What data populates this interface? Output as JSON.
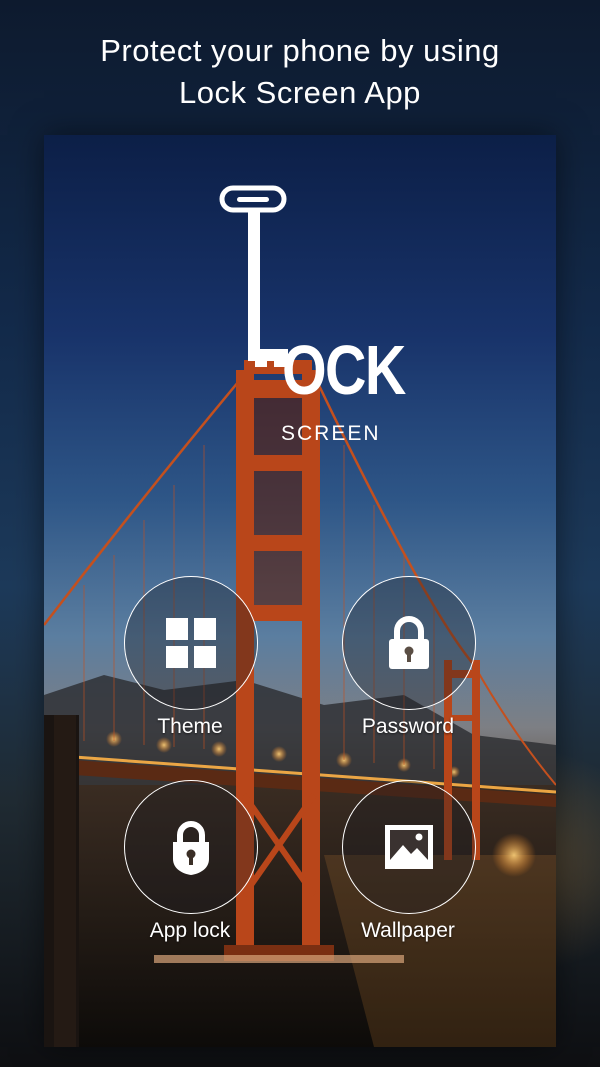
{
  "headline": {
    "line1": "Protect your phone by using",
    "line2": "Lock Screen App"
  },
  "logo": {
    "word": "OCK",
    "subtitle": "SCREEN"
  },
  "menu": {
    "theme": {
      "label": "Theme",
      "icon": "grid-icon"
    },
    "password": {
      "label": "Password",
      "icon": "padlock-icon"
    },
    "app_lock": {
      "label": "App lock",
      "icon": "app-lock-icon"
    },
    "wallpaper": {
      "label": "Wallpaper",
      "icon": "image-icon"
    }
  },
  "colors": {
    "text": "#ffffff",
    "bridge": "#c4501e",
    "lights": "#ffb347"
  }
}
